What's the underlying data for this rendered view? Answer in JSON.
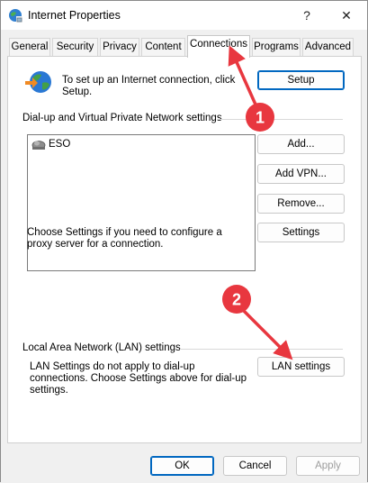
{
  "window": {
    "title": "Internet Properties",
    "help_label": "?",
    "close_label": "✕"
  },
  "tabs": [
    {
      "label": "General"
    },
    {
      "label": "Security"
    },
    {
      "label": "Privacy"
    },
    {
      "label": "Content"
    },
    {
      "label": "Connections",
      "active": true
    },
    {
      "label": "Programs"
    },
    {
      "label": "Advanced"
    }
  ],
  "setup": {
    "text": "To set up an Internet connection, click Setup.",
    "button": "Setup"
  },
  "dialup": {
    "heading": "Dial-up and Virtual Private Network settings",
    "items": [
      {
        "label": "ESO",
        "icon": "network-connection-icon"
      }
    ],
    "add_button": "Add...",
    "add_vpn_button": "Add VPN...",
    "remove_button": "Remove...",
    "proxy_text": "Choose Settings if you need to configure a proxy server for a connection.",
    "settings_button": "Settings"
  },
  "lan": {
    "heading": "Local Area Network (LAN) settings",
    "text": "LAN Settings do not apply to dial-up connections. Choose Settings above for dial-up settings.",
    "button": "LAN settings"
  },
  "footer": {
    "ok": "OK",
    "cancel": "Cancel",
    "apply": "Apply"
  },
  "annotations": [
    {
      "label": "1"
    },
    {
      "label": "2"
    }
  ],
  "colors": {
    "annotation": "#e8373f",
    "accent": "#0067c0"
  }
}
